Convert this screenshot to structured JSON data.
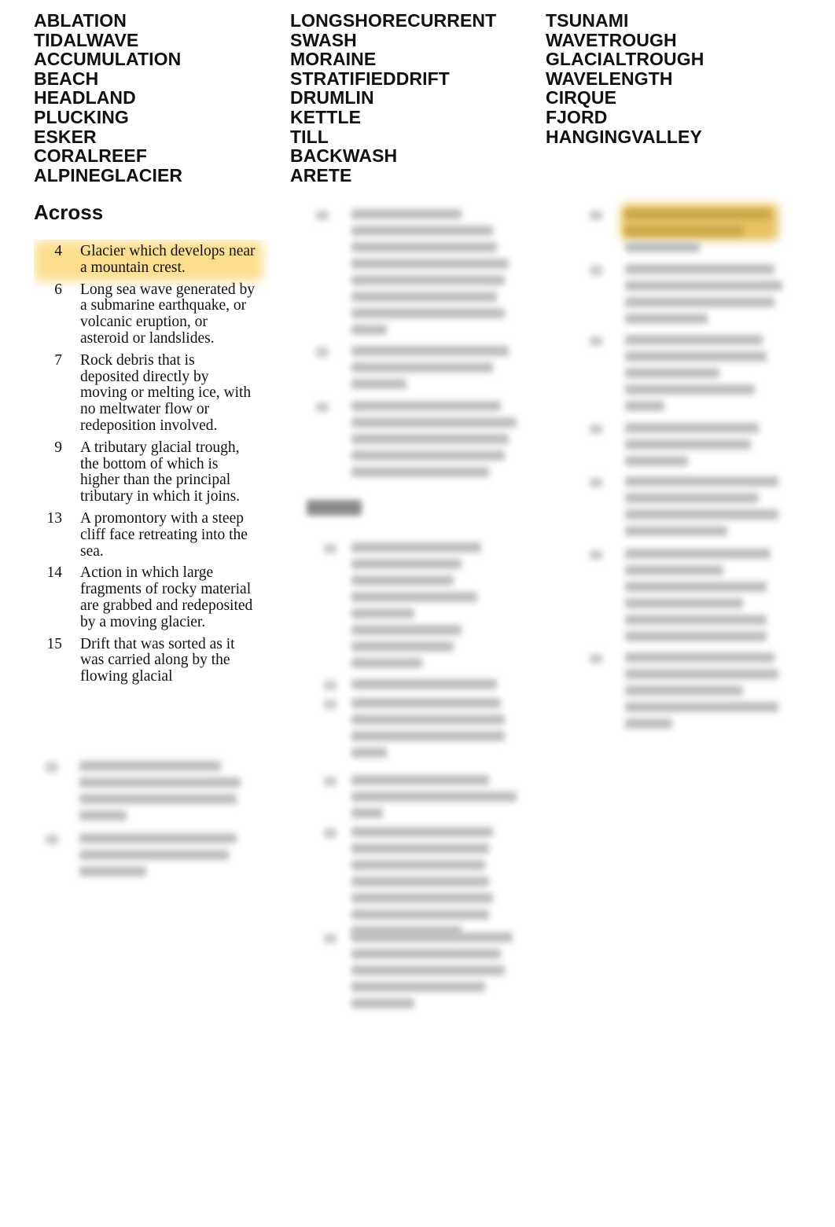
{
  "word_bank": {
    "column_1": [
      "ABLATION",
      "TIDALWAVE",
      "ACCUMULATION",
      "BEACH",
      "HEADLAND",
      "PLUCKING",
      "ESKER",
      "CORALREEF",
      "ALPINEGLACIER"
    ],
    "column_2": [
      "LONGSHORECURRENT",
      "SWASH",
      "MORAINE",
      "STRATIFIEDDRIFT",
      "DRUMLIN",
      "KETTLE",
      "TILL",
      "BACKWASH",
      "ARETE"
    ],
    "column_3": [
      "TSUNAMI",
      "WAVETROUGH",
      "GLACIALTROUGH",
      "WAVELENGTH",
      "CIRQUE",
      "FJORD",
      "HANGINGVALLEY"
    ]
  },
  "across": {
    "heading": "Across",
    "clues": [
      {
        "number": "4",
        "text": "Glacier which develops near a mountain crest.",
        "highlighted": true
      },
      {
        "number": "6",
        "text": "Long sea wave generated by a submarine earthquake, or volcanic eruption, or asteroid or landslides."
      },
      {
        "number": "7",
        "text": "Rock debris that is deposited directly by moving or melting ice, with no meltwater flow or redeposition involved."
      },
      {
        "number": "9",
        "text": "A tributary glacial trough, the bottom of which is higher than the principal tributary in which it joins."
      },
      {
        "number": "13",
        "text": "A promontory with a steep cliff face retreating into the sea."
      },
      {
        "number": "14",
        "text": "Action in which large fragments of rocky material are grabbed and redeposited by a moving glacier."
      },
      {
        "number": "15",
        "text": "Drift that was sorted as it was carried along by the flowing glacial"
      }
    ]
  },
  "colors": {
    "highlight": "#fbd87a",
    "text": "#111111",
    "background": "#ffffff"
  }
}
